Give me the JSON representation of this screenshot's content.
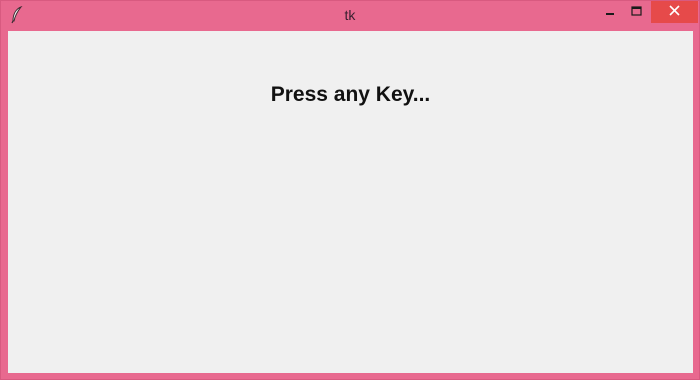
{
  "window": {
    "title": "tk",
    "frame_color": "#e8698f",
    "close_button_color": "#e64a4a",
    "client_background": "#f0f0f0",
    "icons": {
      "app": "feather-icon",
      "minimize": "minimize-icon",
      "maximize": "maximize-icon",
      "close": "close-icon"
    }
  },
  "content": {
    "prompt_text": "Press any Key..."
  }
}
